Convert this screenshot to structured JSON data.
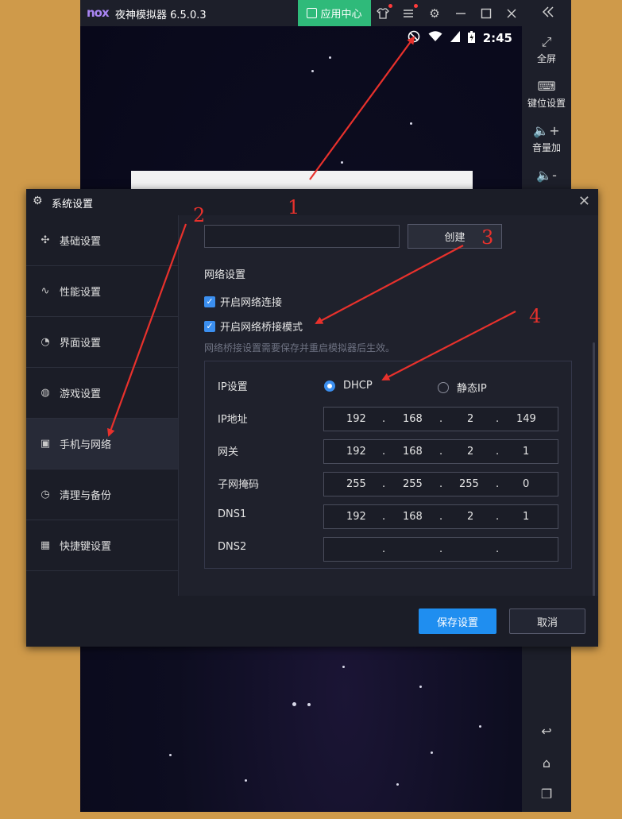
{
  "window": {
    "logo": "nox",
    "title": "夜神模拟器 6.5.0.3",
    "app_center": "应用中心",
    "collapse_icon": "double-chevron-left-icon"
  },
  "status_bar": {
    "time": "2:45"
  },
  "right_sidebar": {
    "items": [
      {
        "icon": "fullscreen-icon",
        "label": "全屏"
      },
      {
        "icon": "keyboard-icon",
        "label": "键位设置"
      },
      {
        "icon": "volume-up-icon",
        "label": "音量加"
      },
      {
        "icon": "volume-down-icon",
        "label": ""
      }
    ]
  },
  "dialog": {
    "title": "系统设置",
    "nav": [
      {
        "icon": "puzzle-icon",
        "label": "基础设置"
      },
      {
        "icon": "pulse-icon",
        "label": "性能设置"
      },
      {
        "icon": "palette-icon",
        "label": "界面设置"
      },
      {
        "icon": "gamepad-icon",
        "label": "游戏设置"
      },
      {
        "icon": "phone-icon",
        "label": "手机与网络"
      },
      {
        "icon": "history-icon",
        "label": "清理与备份"
      },
      {
        "icon": "keyboard-icon",
        "label": "快捷键设置"
      }
    ],
    "active_nav": "手机与网络",
    "create_label": "创建",
    "network_heading": "网络设置",
    "enable_network": {
      "label": "开启网络连接",
      "checked": true
    },
    "enable_bridge": {
      "label": "开启网络桥接模式",
      "checked": true
    },
    "hint": "网络桥接设置需要保存并重启模拟器后生效。",
    "ip_setting_label": "IP设置",
    "radio_dhcp": "DHCP",
    "radio_static": "静态IP",
    "selected_mode": "DHCP",
    "fields": [
      {
        "label": "IP地址",
        "octets": [
          "192",
          "168",
          "2",
          "149"
        ]
      },
      {
        "label": "网关",
        "octets": [
          "192",
          "168",
          "2",
          "1"
        ]
      },
      {
        "label": "子网掩码",
        "octets": [
          "255",
          "255",
          "255",
          "0"
        ]
      },
      {
        "label": "DNS1",
        "octets": [
          "192",
          "168",
          "2",
          "1"
        ]
      },
      {
        "label": "DNS2",
        "octets": [
          "",
          "",
          "",
          ""
        ]
      }
    ],
    "save_label": "保存设置",
    "cancel_label": "取消"
  },
  "annotations": [
    "1",
    "2",
    "3",
    "4"
  ],
  "colors": {
    "accent": "#1f8ef0",
    "annotation": "#e8312c",
    "appcenter": "#2fba7a"
  }
}
